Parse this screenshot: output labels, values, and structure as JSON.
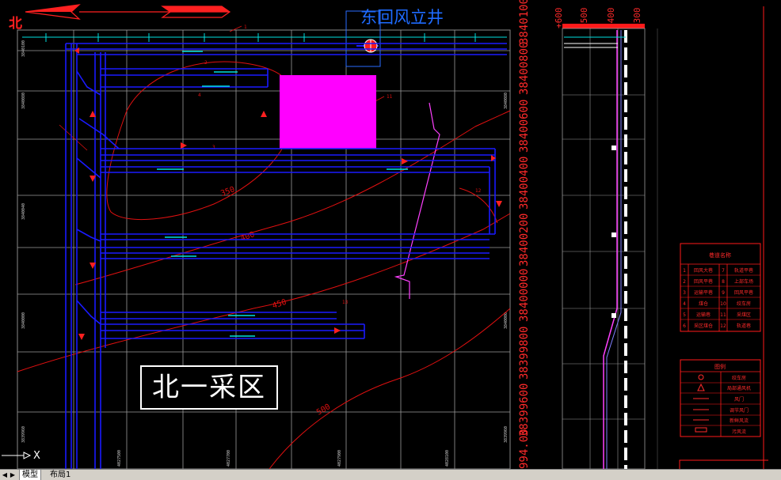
{
  "drawing": {
    "area_name": "北一采区",
    "shaft_label": "东回风立井",
    "north_label": "北",
    "contours": [
      "350",
      "400",
      "450",
      "500"
    ],
    "callouts": [
      "1",
      "2",
      "3",
      "4",
      "11",
      "12",
      "13"
    ],
    "right_axis_labels": [
      "38401000",
      "38400800",
      "38400600",
      "38400400",
      "38400200",
      "38400000",
      "38399800",
      "38399600",
      "994.00"
    ],
    "elevation_labels": [
      "+600",
      "+500",
      "+400",
      "+300"
    ]
  },
  "legend_names": {
    "title": "巷道名称",
    "rows": [
      [
        "1",
        "回风大巷",
        "7",
        "轨道平巷"
      ],
      [
        "2",
        "回风平巷",
        "8",
        "上部车场"
      ],
      [
        "3",
        "运输平巷",
        "9",
        "回风平巷"
      ],
      [
        "4",
        "煤仓",
        "10",
        "绞车房"
      ],
      [
        "5",
        "运输巷",
        "11",
        "采煤区"
      ],
      [
        "6",
        "采区煤仓",
        "12",
        "轨道巷"
      ]
    ]
  },
  "legend_symbols": {
    "title": "图例",
    "items": [
      "绞车房",
      "局部通风机",
      "风门",
      "调节风门",
      "新鲜风流",
      "污风流"
    ]
  },
  "tabs": {
    "model": "模型",
    "layout1": "布局1"
  },
  "colors": {
    "background": "#000000",
    "roadway": "#1a1aff",
    "contour": "#e01010",
    "grid": "#9a9a9a",
    "block": "#ff00ff",
    "profile": "#c040c0"
  }
}
